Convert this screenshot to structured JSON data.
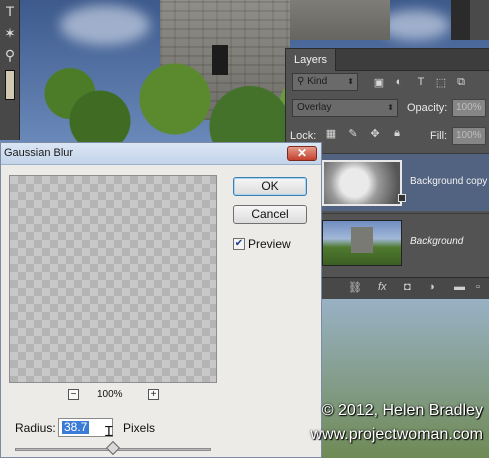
{
  "toolbar": {
    "tools": [
      "T",
      "✶",
      "⚲"
    ]
  },
  "layers_panel": {
    "tab_label": "Layers",
    "filter_kind": "Kind",
    "blend_mode": "Overlay",
    "opacity_label": "Opacity:",
    "opacity_value": "100%",
    "lock_label": "Lock:",
    "fill_label": "Fill:",
    "fill_value": "100%",
    "layers": [
      {
        "name": "Background copy",
        "selected": true,
        "italic": false
      },
      {
        "name": "Background",
        "selected": false,
        "italic": true
      }
    ],
    "footer_icons": [
      "link-icon",
      "fx-icon",
      "mask-icon",
      "adjustment-icon",
      "folder-icon",
      "new-layer-icon",
      "trash-icon"
    ],
    "fx_label": "fx"
  },
  "dialog": {
    "title": "Gaussian Blur",
    "close_glyph": "✕",
    "ok_label": "OK",
    "cancel_label": "Cancel",
    "preview_label": "Preview",
    "preview_checked": true,
    "zoom_minus": "−",
    "zoom_plus": "+",
    "zoom_value": "100%",
    "radius_label": "Radius:",
    "radius_value": "38.7",
    "radius_unit": "Pixels",
    "slider_fraction": 0.5
  },
  "watermark": {
    "copyright": "© 2012, Helen Bradley",
    "website": "www.projectwoman.com"
  },
  "colors": {
    "selected_layer": "#516381",
    "close_button": "#c4412d",
    "selection_highlight": "#3a7bd5"
  }
}
